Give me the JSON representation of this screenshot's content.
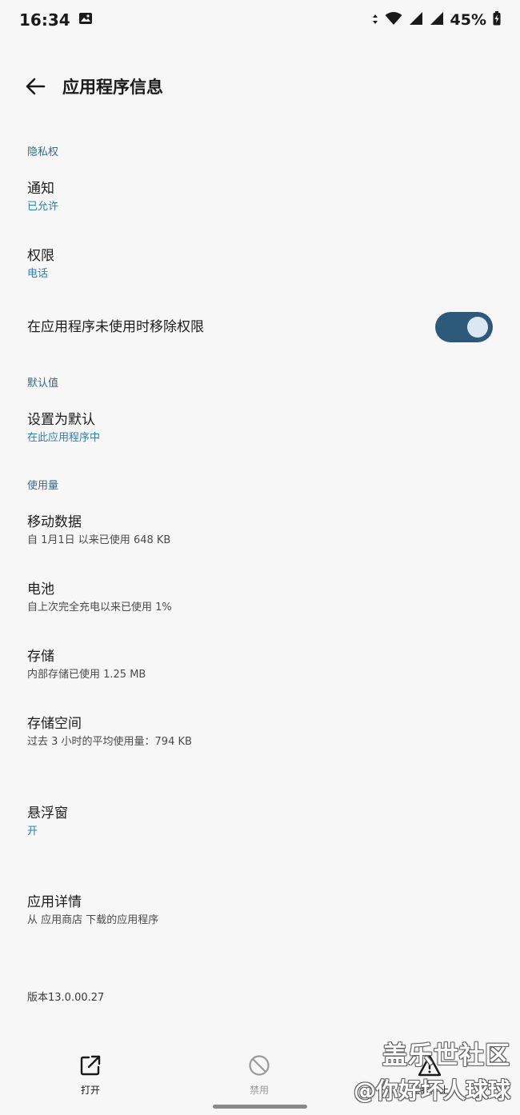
{
  "status_bar": {
    "time": "16:34",
    "battery": "45%"
  },
  "app_bar": {
    "title": "应用程序信息"
  },
  "sections": {
    "privacy": "隐私权",
    "defaults": "默认值",
    "usage": "使用量"
  },
  "items": {
    "notifications": {
      "title": "通知",
      "sub": "已允许"
    },
    "permissions": {
      "title": "权限",
      "sub": "电话"
    },
    "remove_permissions": {
      "title": "在应用程序未使用时移除权限",
      "enabled": true
    },
    "set_default": {
      "title": "设置为默认",
      "sub": "在此应用程序中"
    },
    "mobile_data": {
      "title": "移动数据",
      "sub": "自 1月1日 以来已使用 648 KB"
    },
    "battery": {
      "title": "电池",
      "sub": "自上次完全充电以来已使用 1%"
    },
    "storage": {
      "title": "存储",
      "sub": "内部存储已使用 1.25 MB"
    },
    "memory": {
      "title": "存储空间",
      "sub": "过去 3 小时的平均使用量：794 KB"
    },
    "floating_window": {
      "title": "悬浮窗",
      "sub": "开"
    },
    "app_details": {
      "title": "应用详情",
      "sub": "从 应用商店 下载的应用程序"
    }
  },
  "version": "版本13.0.00.27",
  "actions": {
    "open": "打开",
    "disable": "禁用",
    "force_stop": "强制停止"
  },
  "watermark": {
    "line1": "盖乐世社区",
    "line2": "@你好坏人球球"
  },
  "colors": {
    "accent": "#2f7fae",
    "toggle_on": "#2d5a7b",
    "section": "#3a6a82"
  }
}
